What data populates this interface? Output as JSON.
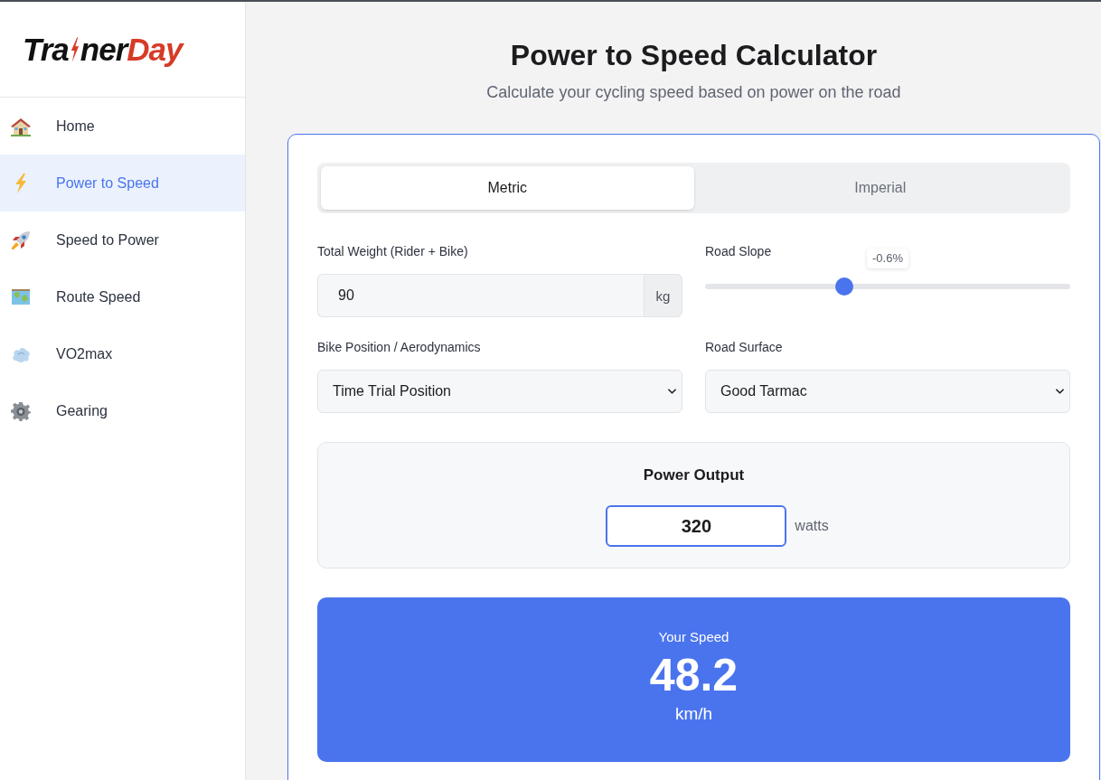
{
  "logo": {
    "lead": "Tra",
    "middle": "ner",
    "accent": "Day"
  },
  "sidebar": {
    "items": [
      {
        "label": "Home",
        "selected": false
      },
      {
        "label": "Power to Speed",
        "selected": true
      },
      {
        "label": "Speed to Power",
        "selected": false
      },
      {
        "label": "Route Speed",
        "selected": false
      },
      {
        "label": "VO2max",
        "selected": false
      },
      {
        "label": "Gearing",
        "selected": false
      }
    ]
  },
  "header": {
    "title": "Power to Speed Calculator",
    "subtitle": "Calculate your cycling speed based on power on the road"
  },
  "calculator": {
    "unit_tabs": [
      {
        "label": "Metric",
        "selected": true
      },
      {
        "label": "Imperial",
        "selected": false
      }
    ],
    "fields": [
      {
        "kind": "number",
        "label": "Total Weight (Rider + Bike)",
        "value": "90",
        "unit": "kg"
      },
      {
        "kind": "slider",
        "label": "Road Slope",
        "level": 0.38,
        "reading": "-0.6%"
      },
      {
        "kind": "select",
        "label": "Bike Position / Aerodynamics",
        "value": "Time Trial Position"
      },
      {
        "kind": "select",
        "label": "Road Surface",
        "value": "Good Tarmac"
      }
    ],
    "power_output": {
      "label": "Power Output",
      "value": "320",
      "unit": "watts"
    },
    "result": {
      "label": "Your Speed",
      "value": "48.2",
      "unit": "km/h"
    }
  }
}
